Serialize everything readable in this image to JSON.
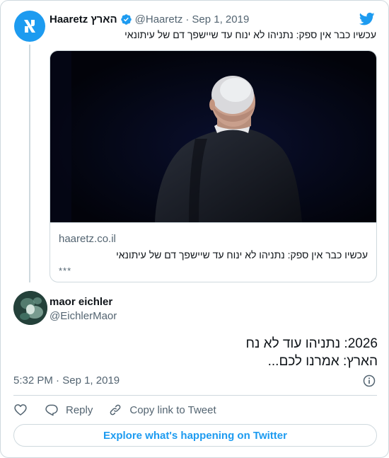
{
  "quoted_tweet": {
    "author_name": "Haaretz הארץ",
    "handle": "@Haaretz",
    "separator": "·",
    "date": "Sep 1, 2019",
    "text": "עכשיו כבר אין ספק: נתניהו לא ינוח עד שיישפך דם של עיתונאי",
    "link_card": {
      "domain": "haaretz.co.il",
      "title": "עכשיו כבר אין ספק: נתניהו לא ינוח עד שיישפך דם של עיתונאי",
      "description": "***"
    }
  },
  "tweet": {
    "author_name": "maor eichler",
    "handle": "@EichlerMaor",
    "text_line1": "2026: נתניהו עוד לא נח",
    "text_line2": "הארץ: אמרנו לכם...",
    "time": "5:32 PM",
    "separator": "·",
    "date": "Sep 1, 2019"
  },
  "actions": {
    "like_icon": "heart-icon",
    "reply_label": "Reply",
    "copy_link_label": "Copy link to Tweet"
  },
  "footer": {
    "explore_label": "Explore what's happening on Twitter"
  },
  "colors": {
    "accent": "#1d9bf0",
    "secondary_text": "#536471",
    "border": "#cfd9de"
  }
}
